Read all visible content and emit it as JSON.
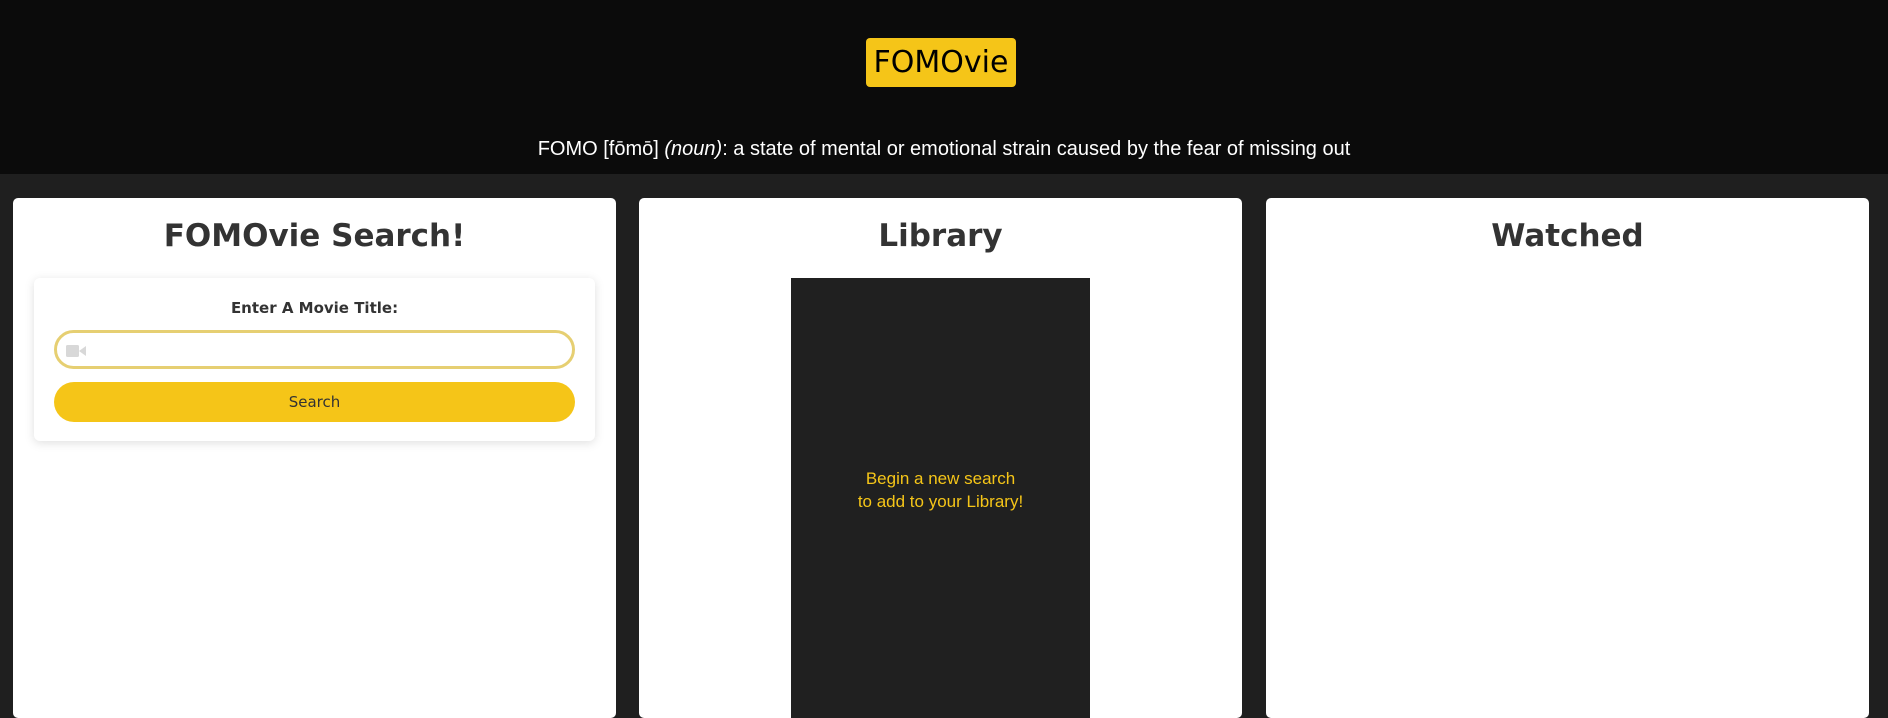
{
  "header": {
    "logo": "FOMOvie",
    "tagline": {
      "term": "FOMO [fōmō] ",
      "pos": "(noun)",
      "definition": ": a state of mental or emotional strain caused by the fear of missing out"
    }
  },
  "search_panel": {
    "title": "FOMOvie Search!",
    "label": "Enter A Movie Title:",
    "input_value": "",
    "input_icon": "video-camera-icon",
    "button_label": "Search"
  },
  "library_panel": {
    "title": "Library",
    "empty_line1": "Begin a new search",
    "empty_line2": "to add to your Library!"
  },
  "watched_panel": {
    "title": "Watched"
  },
  "colors": {
    "accent": "#f5c518",
    "header_bg": "#0b0b0b",
    "page_bg": "#1f1f1f",
    "library_bg": "#202020"
  }
}
